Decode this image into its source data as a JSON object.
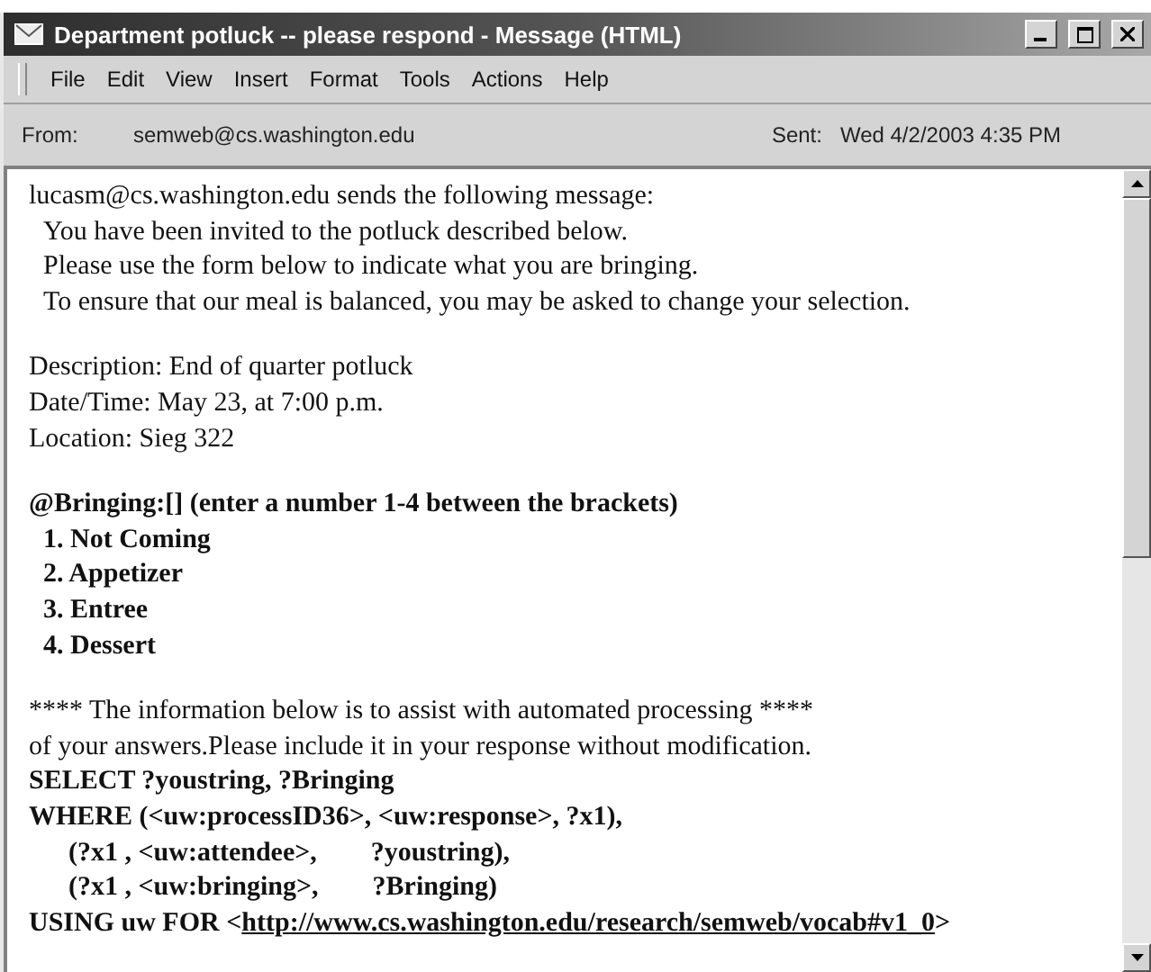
{
  "window": {
    "title": "Department potluck -- please respond - Message (HTML)"
  },
  "menu": [
    "File",
    "Edit",
    "View",
    "Insert",
    "Format",
    "Tools",
    "Actions",
    "Help"
  ],
  "header": {
    "from_label": "From:",
    "from": "semweb@cs.washington.edu",
    "sent_label": "Sent:",
    "sent": "Wed 4/2/2003 4:35 PM"
  },
  "body": [
    [
      {
        "kind": "plain",
        "indented": false,
        "text": "lucasm@cs.washington.edu sends the following message:"
      },
      {
        "kind": "plain",
        "indented": true,
        "text": "You have been invited to the potluck described below."
      },
      {
        "kind": "plain",
        "indented": true,
        "text": "Please use the form below to indicate what you are bringing."
      },
      {
        "kind": "plain",
        "indented": true,
        "text": "To ensure that our meal is balanced, you may be asked to change your selection."
      }
    ],
    [
      {
        "kind": "plain",
        "indented": false,
        "text": "Description: End of quarter potluck"
      },
      {
        "kind": "plain",
        "indented": false,
        "text": "Date/Time: May 23, at 7:00 p.m."
      },
      {
        "kind": "plain",
        "indented": false,
        "text": "Location: Sieg 322"
      }
    ],
    [
      {
        "kind": "bold",
        "indented": false,
        "text": "@Bringing:[] (enter a number 1-4 between the brackets)"
      },
      {
        "kind": "bold",
        "indented": true,
        "text": "1. Not Coming"
      },
      {
        "kind": "bold",
        "indented": true,
        "text": "2. Appetizer"
      },
      {
        "kind": "bold",
        "indented": true,
        "text": "3. Entree"
      },
      {
        "kind": "bold",
        "indented": true,
        "text": "4. Dessert"
      }
    ],
    [
      {
        "kind": "plain",
        "indented": false,
        "text": "**** The information below is to assist with automated processing ****"
      },
      {
        "kind": "plain",
        "indented": false,
        "text": "of your answers.Please include it in your response without modification."
      },
      {
        "kind": "bold",
        "indented": false,
        "text": "SELECT ?youstring, ?Bringing"
      },
      {
        "kind": "bold",
        "indented": false,
        "text": "WHERE (<uw:processID36>, <uw:response>, ?x1),"
      },
      {
        "kind": "code",
        "indented": true,
        "text": "(?x1 , <uw:attendee>,        ?youstring),"
      },
      {
        "kind": "code",
        "indented": true,
        "text": "(?x1 , <uw:bringing>,        ?Bringing)"
      },
      {
        "kind": "link",
        "indented": false,
        "text": "USING uw FOR <",
        "link": "http://www.cs.washington.edu/research/semweb/vocab#v1_0",
        "after": ">"
      }
    ]
  ]
}
